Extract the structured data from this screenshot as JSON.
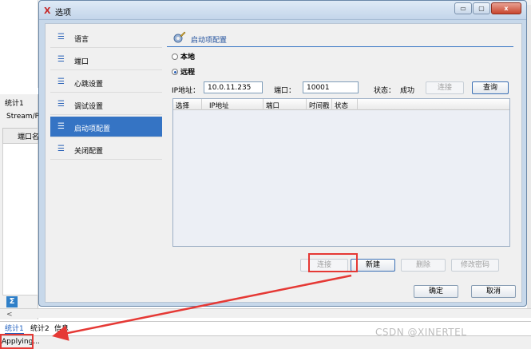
{
  "background": {
    "tab_stat1": "统计1",
    "stream_label": "Stream/Po",
    "port_name_header": "端口名",
    "sigma_icon": "Σ"
  },
  "bottom_tabs": [
    "统计1",
    "统计2",
    "信息"
  ],
  "status": {
    "text": "Applying..."
  },
  "watermark": "CSDN @XINERTEL",
  "dialog": {
    "title": "选项",
    "app_icon": "X",
    "window_buttons": {
      "minimize": "▭",
      "maximize": "▢",
      "close": "x"
    }
  },
  "nav": {
    "items": [
      {
        "label": "语言",
        "icon": "list-icon"
      },
      {
        "label": "端口",
        "icon": "list-icon"
      },
      {
        "label": "心跳设置",
        "icon": "list-icon"
      },
      {
        "label": "调试设置",
        "icon": "list-icon"
      },
      {
        "label": "启动项配置",
        "icon": "list-icon",
        "active": true
      },
      {
        "label": "关闭配置",
        "icon": "list-icon"
      }
    ]
  },
  "panel": {
    "section_title": "启动项配置",
    "radio_local": "本地",
    "radio_remote": "远程",
    "selected_mode": "远程",
    "ip_label": "IP地址：",
    "ip_value": "10.0.11.235",
    "port_label": "端口：",
    "port_value": "10001",
    "state_label": "状态：",
    "state_value": "成功",
    "connect_top": "连接",
    "query": "查询",
    "table": {
      "columns": [
        "选择",
        "IP地址",
        "端口",
        "时间戳",
        "状态"
      ],
      "rows": []
    },
    "buttons": {
      "connect": "连接",
      "new": "新建",
      "delete": "删除",
      "change_password": "修改密码"
    },
    "ok": "确定",
    "cancel": "取消"
  },
  "annotation_color": "#e53935"
}
